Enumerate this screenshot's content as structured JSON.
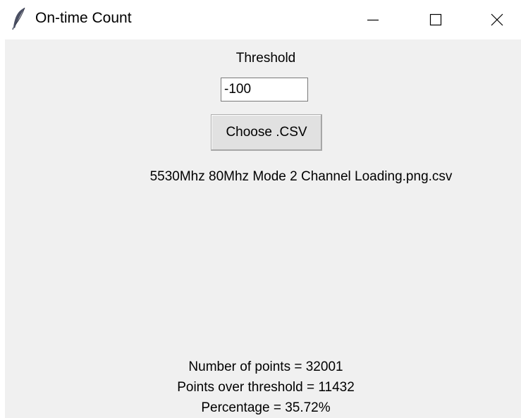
{
  "window": {
    "title": "On-time Count",
    "icon": "feather-icon"
  },
  "controls": {
    "minimize_icon": "minimize-icon",
    "maximize_icon": "maximize-icon",
    "close_icon": "close-icon"
  },
  "form": {
    "threshold_label": "Threshold",
    "threshold_value": "-100",
    "choose_button_label": "Choose .CSV",
    "selected_file": "5530Mhz 80Mhz Mode 2 Channel Loading.png.csv"
  },
  "results": {
    "number_of_points": "Number of points = 32001",
    "points_over_threshold": "Points over threshold = 11432",
    "percentage": "Percentage = 35.72%"
  }
}
